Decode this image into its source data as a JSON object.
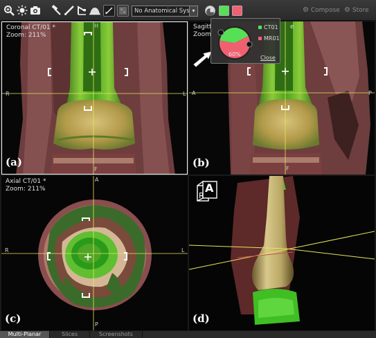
{
  "toolbar": {
    "icons": [
      "zoom-icon",
      "brightness-icon",
      "camera-icon",
      "hammer-icon",
      "ruler-icon",
      "angle-icon",
      "volume-icon",
      "measure-icon",
      "texture-icon"
    ],
    "system_select": "No Anatomical System",
    "swatch_colors": {
      "gray": "#9a9a9a",
      "green": "#55e055",
      "red": "#f06070"
    },
    "compose_label": "Compose",
    "store_label": "Store"
  },
  "viewports": {
    "a": {
      "title": "Coronal CT/01 *",
      "zoom": "Zoom: 211%",
      "letter": "(a)",
      "top": "H",
      "left": "R",
      "right": "L",
      "bottom": "F"
    },
    "b": {
      "title": "Sagitt",
      "title_tail": "e",
      "zoom": "Zoom",
      "letter": "(b)",
      "left": "A",
      "right": "P",
      "bottom": "F"
    },
    "c": {
      "title": "Axial CT/01 *",
      "zoom": "Zoom: 211%",
      "letter": "(c)",
      "top": "A",
      "left": "R",
      "right": "L",
      "bottom": "P"
    },
    "d": {
      "letter": "(d)",
      "cube_face": "A"
    }
  },
  "blend_popup": {
    "percent": "60%",
    "mix_fraction": 0.6,
    "legend": [
      {
        "label": "CT01",
        "color": "#55e055"
      },
      {
        "label": "MR01",
        "color": "#f06070"
      }
    ],
    "close_label": "Close"
  },
  "tabs": [
    {
      "label": "Multi-Planar",
      "active": true
    },
    {
      "label": "Slices",
      "active": false
    },
    {
      "label": "Screenshots",
      "active": false
    }
  ]
}
